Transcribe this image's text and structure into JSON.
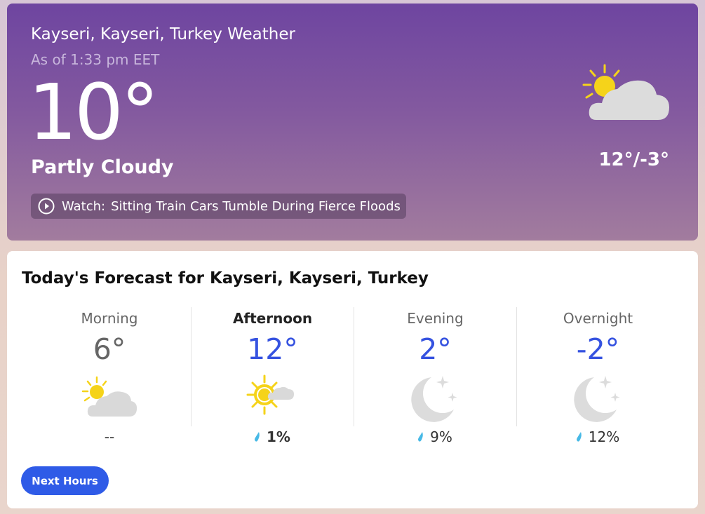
{
  "current": {
    "location": "Kayseri, Kayseri, Turkey Weather",
    "as_of": "As of 1:33 pm EET",
    "temperature": "10°",
    "condition": "Partly Cloudy",
    "hi_lo": "12°/-3°",
    "icon": "partly-cloudy-icon",
    "watch_prefix": "Watch:",
    "watch_title": "Sitting Train Cars Tumble During Fierce Floods"
  },
  "forecast": {
    "title": "Today's Forecast for Kayseri, Kayseri, Turkey",
    "periods": [
      {
        "name": "Morning",
        "temp": "6°",
        "icon": "partly-cloudy-icon",
        "precip": "--"
      },
      {
        "name": "Afternoon",
        "temp": "12°",
        "icon": "mostly-sunny-icon",
        "precip": "1%"
      },
      {
        "name": "Evening",
        "temp": "2°",
        "icon": "clear-night-icon",
        "precip": "9%"
      },
      {
        "name": "Overnight",
        "temp": "-2°",
        "icon": "clear-night-icon",
        "precip": "12%"
      }
    ],
    "next_button": "Next Hours"
  },
  "colors": {
    "accent": "#2f5be7",
    "temp_blue": "#3552e0",
    "hero_top": "#6e45a0",
    "hero_bottom": "#a27c9e",
    "drop": "#47b9e6",
    "sun": "#f5d31a"
  }
}
